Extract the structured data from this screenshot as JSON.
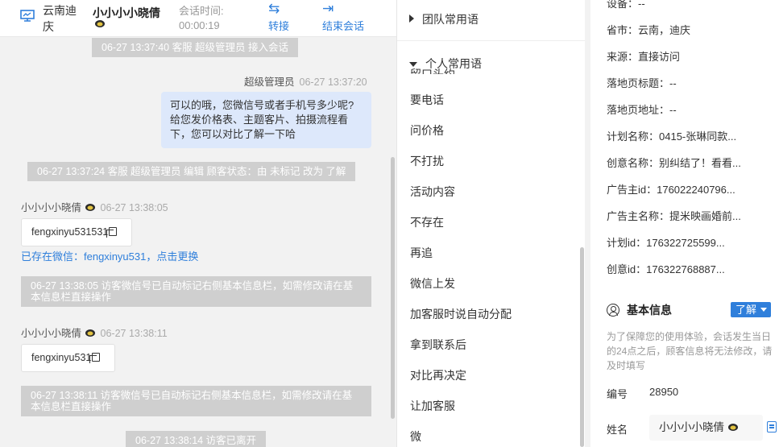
{
  "header": {
    "location": "云南迪庆",
    "customer_name": "小小小小晓倩",
    "session_label": "会话时间:",
    "session_time": "00:00:19",
    "transfer_label": "转接",
    "end_label": "结束会话"
  },
  "chat": {
    "sys1": "06-27 13:37:40 客服 超级管理员 接入会话",
    "agent_name": "超级管理员",
    "agent_time": "06-27 13:37:20",
    "agent_message": "可以的哦，您微信号或者手机号多少呢?给您发价格表、主题客片、拍摄流程看下，您可以对比了解一下哈",
    "sys2": "06-27 13:37:24 客服 超级管理员 编辑 顾客状态：由 未标记 改为 了解",
    "visitor_name": "小小小小晓倩",
    "visitor_time1": "06-27 13:38:05",
    "visitor_msg1": "fengxinyu531531",
    "wechat_link": "已存在微信：fengxinyu531，点击更换",
    "sys3": "06-27 13:38:05 访客微信号已自动标记右侧基本信息栏，如需修改请在基本信息栏直接操作",
    "visitor_time2": "06-27 13:38:11",
    "visitor_msg2": "fengxinyu531",
    "sys4": "06-27 13:38:11 访客微信号已自动标记右侧基本信息栏，如需修改请在基本信息栏直接操作",
    "sys5": "06-27 13:38:14 访客已离开"
  },
  "phrases": {
    "team_group": "团队常用语",
    "personal_group": "个人常用语",
    "cut_item": "留口头约",
    "items": [
      "要电话",
      "问价格",
      "不打扰",
      "活动内容",
      "不存在",
      "再追",
      "微信上发",
      "加客服时说自动分配",
      "拿到联系后",
      "对比再决定",
      "让加客服",
      "微"
    ]
  },
  "info": {
    "device": "设备：--",
    "province": "省市：云南，迪庆",
    "source": "来源：直接访问",
    "landing_title": "落地页标题：--",
    "landing_url": "落地页地址：--",
    "plan_name": "计划名称：0415-张琳同款...",
    "creative_name": "创意名称：别纠结了！看看...",
    "advertiser_id": "广告主id：176022240796...",
    "advertiser_name": "广告主名称：提米映画婚前...",
    "plan_id": "计划id：176322725599...",
    "creative_id": "创意id：176322768887...",
    "basic_info": "基本信息",
    "status_badge": "了解",
    "notice": "为了保障您的使用体验，会话发生当日的24点之后，顾客信息将无法修改，请及时填写",
    "number_label": "编号",
    "number_value": "28950",
    "name_label": "姓名",
    "name_value": "小小小小晓倩"
  },
  "colors": {
    "accent": "#2f7fdb",
    "bubble": "#dde8fb",
    "system": "#cfcfcf"
  }
}
